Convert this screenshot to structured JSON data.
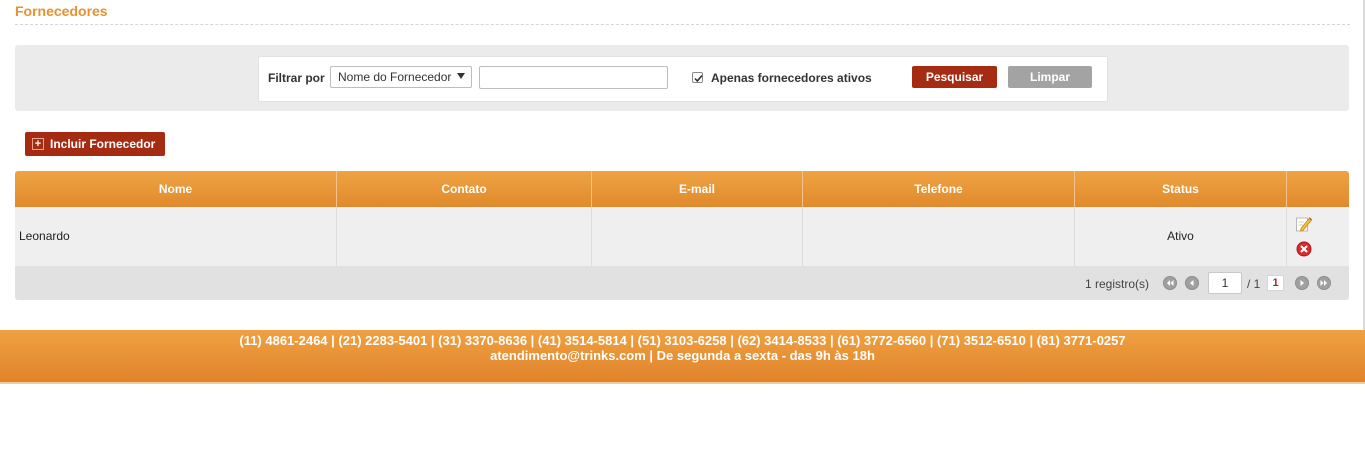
{
  "page": {
    "title": "Fornecedores"
  },
  "filter": {
    "label": "Filtrar por",
    "select_value": "Nome do Fornecedor",
    "text_value": "",
    "active_only_checked": true,
    "active_only_label": "Apenas fornecedores ativos",
    "search_button": "Pesquisar",
    "clear_button": "Limpar"
  },
  "actions": {
    "add_supplier": "Incluir Fornecedor"
  },
  "table": {
    "columns": [
      "Nome",
      "Contato",
      "E-mail",
      "Telefone",
      "Status",
      ""
    ],
    "rows": [
      {
        "nome": "Leonardo",
        "contato": "",
        "email": "",
        "telefone": "",
        "status": "Ativo",
        "actions": [
          "edit-icon",
          "delete-icon"
        ]
      }
    ]
  },
  "pager": {
    "count_text": "1 registro(s)",
    "page_input": "1",
    "of_text": "/ 1",
    "current_page": "1"
  },
  "footer": {
    "phones": "(11) 4861-2464 | (21) 2283-5401 | (31) 3370-8636 | (41) 3514-5814 | (51) 3103-6258 | (62) 3414-8533 | (61) 3772-6560 | (71) 3512-6510 | (81) 3771-0257",
    "contact": "atendimento@trinks.com  |  De segunda a sexta - das 9h às 18h"
  },
  "colors": {
    "accent_orange": "#e8912e",
    "primary_button": "#a52c12",
    "secondary_button": "#a3a3a3"
  }
}
